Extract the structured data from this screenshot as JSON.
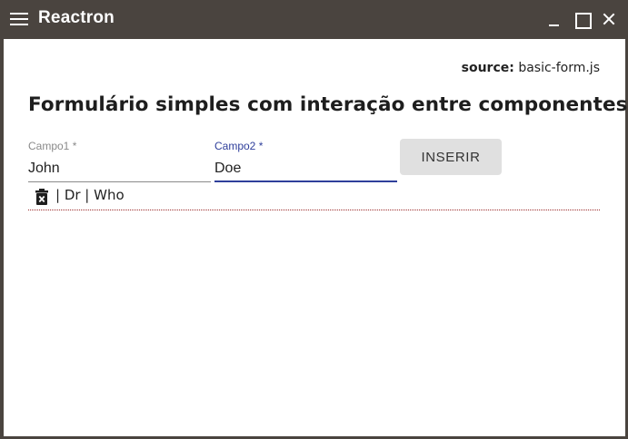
{
  "window": {
    "title": "Reactron",
    "controls": [
      "menu-icon",
      "minimize-icon",
      "maximize-icon",
      "close-icon"
    ]
  },
  "page": {
    "source_label": "source:",
    "source_file": "basic-form.js",
    "heading": "Formulário simples com interação entre componentes."
  },
  "form": {
    "field1": {
      "label": "Campo1 *",
      "value": "John"
    },
    "field2": {
      "label": "Campo2 *",
      "value": "Doe",
      "focused": true
    },
    "insert_button": "INSERIR"
  },
  "list": {
    "items": [
      {
        "icon": "trash-icon",
        "text": "| Dr | Who"
      }
    ]
  },
  "colors": {
    "titlebar": "#4a443f",
    "accent": "#2f3f9b",
    "button_bg": "#e0e0e0",
    "row_divider": "#9b2b2b"
  }
}
